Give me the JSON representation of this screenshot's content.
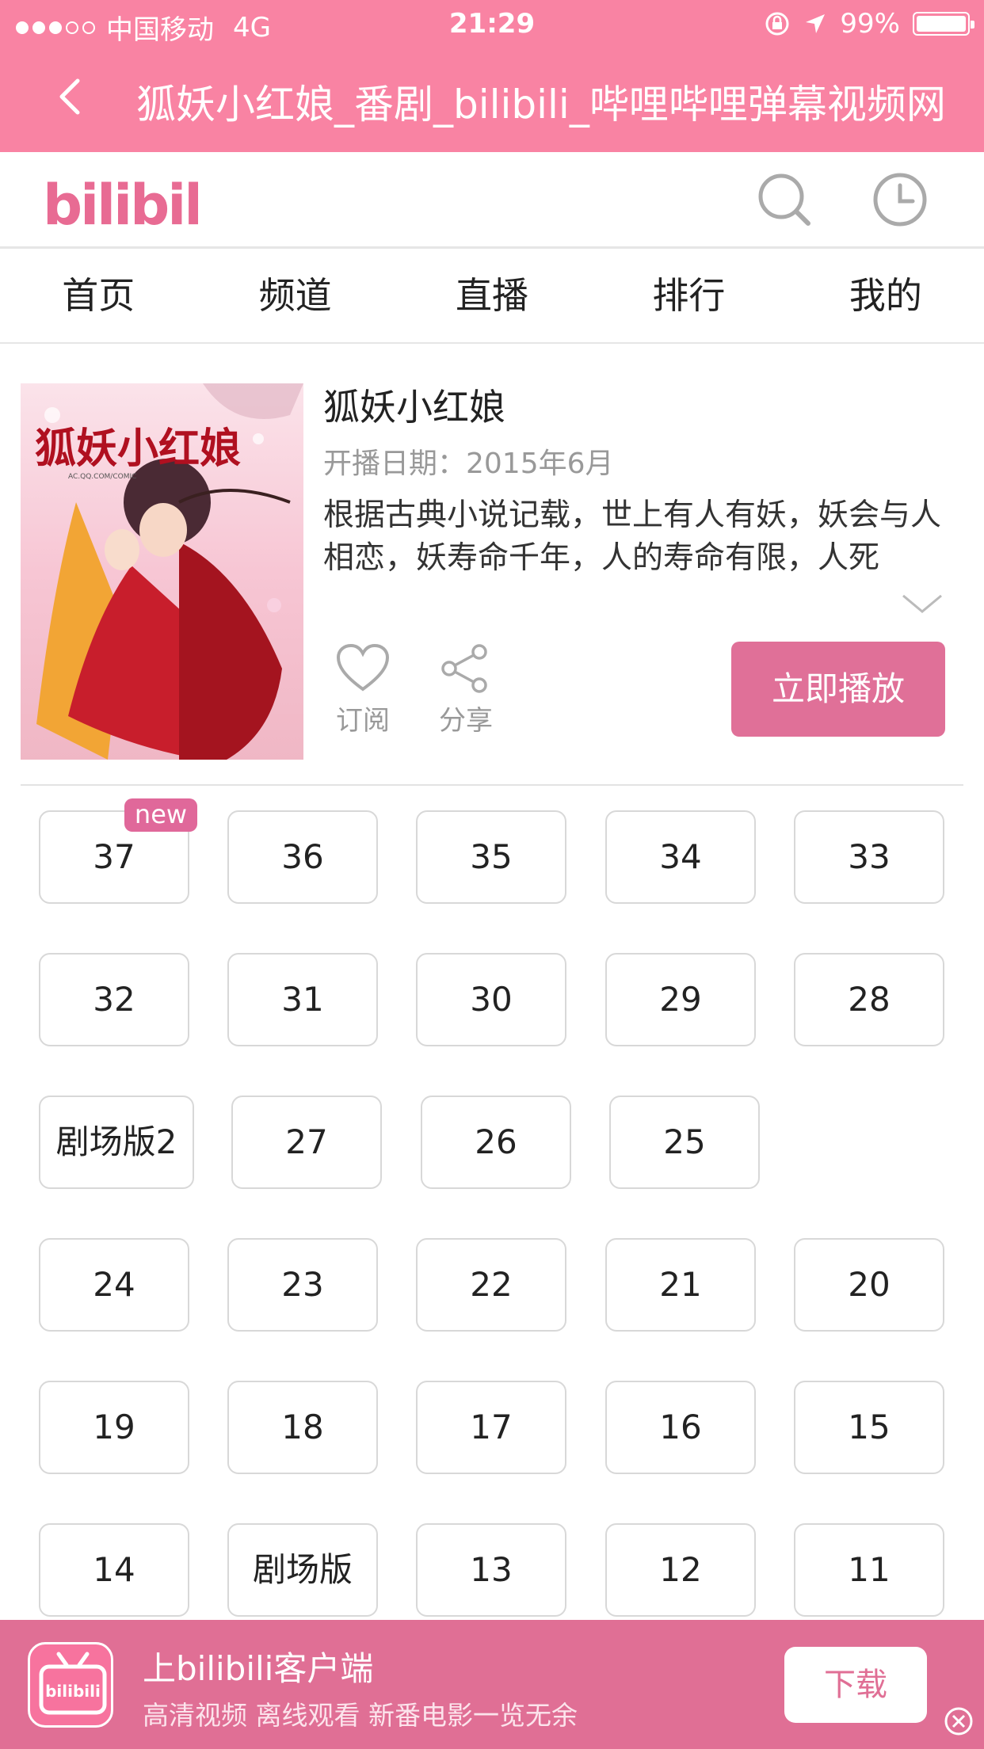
{
  "status_bar": {
    "carrier": "中国移动",
    "network": "4G",
    "time": "21:29",
    "battery": "99%"
  },
  "title_bar": {
    "title": "狐妖小红娘_番剧_bilibili_哔哩哔哩弹幕视频网"
  },
  "header": {
    "logo_text": "bilibili",
    "search_icon": "search-icon",
    "history_icon": "clock-icon"
  },
  "nav": {
    "items": [
      "首页",
      "频道",
      "直播",
      "排行",
      "我的"
    ]
  },
  "anime": {
    "title": "狐妖小红娘",
    "air_date": "开播日期：2015年6月",
    "description": "根据古典小说记载，世上有人有妖，妖会与人相恋，妖寿命千年，人的寿命有限，人死",
    "cover_text": "狐妖小红娘",
    "subscribe_label": "订阅",
    "share_label": "分享",
    "play_label": "立即播放"
  },
  "episodes": {
    "new_badge": "new",
    "rows": [
      [
        "37",
        "36",
        "35",
        "34",
        "33"
      ],
      [
        "32",
        "31",
        "30",
        "29",
        "28"
      ],
      [
        "剧场版2",
        "27",
        "26",
        "25"
      ],
      [
        "24",
        "23",
        "22",
        "21",
        "20"
      ],
      [
        "19",
        "18",
        "17",
        "16",
        "15"
      ],
      [
        "14",
        "剧场版",
        "13",
        "12",
        "11"
      ]
    ]
  },
  "banner": {
    "title": "上bilibili客户端",
    "subtitle": "高清视频 离线观看 新番电影一览无余",
    "download_label": "下载",
    "app_icon_text": "bilibili"
  },
  "colors": {
    "brand_pink": "#f983a3",
    "button_pink": "#e07098",
    "banner_pink": "#e06f95"
  }
}
